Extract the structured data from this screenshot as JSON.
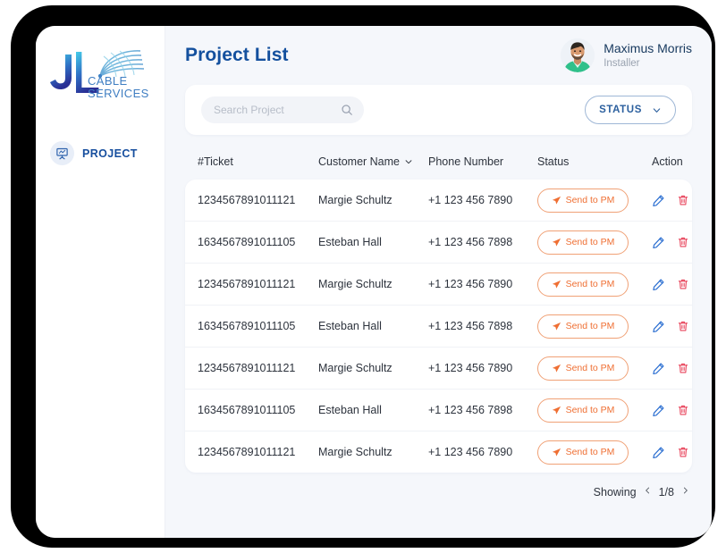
{
  "brand": {
    "initials": "JL",
    "line1": "CABLE",
    "line2": "SERVICES",
    "colors": {
      "gradient_start": "#3fc9e8",
      "gradient_end": "#2b3fa0"
    }
  },
  "sidebar": {
    "items": [
      {
        "label": "PROJECT",
        "icon": "project-board-icon",
        "active": true
      }
    ]
  },
  "header": {
    "title": "Project List",
    "user": {
      "name": "Maximus Morris",
      "role": "Installer",
      "avatar": "user-photo"
    }
  },
  "search": {
    "placeholder": "Search Project",
    "value": "",
    "icon": "search-icon"
  },
  "status_filter": {
    "label": "STATUS",
    "icon": "chevron-down-icon",
    "border_color": "#9fb7d6",
    "text_color": "#2b5f9e"
  },
  "table": {
    "columns": [
      {
        "key": "ticket",
        "label": "#Ticket",
        "sortable": false
      },
      {
        "key": "name",
        "label": "Customer Name",
        "sortable": true,
        "icon": "chevron-down-icon"
      },
      {
        "key": "phone",
        "label": "Phone Number",
        "sortable": false
      },
      {
        "key": "status",
        "label": "Status",
        "sortable": false
      },
      {
        "key": "action",
        "label": "Action",
        "sortable": false
      }
    ],
    "status_action": {
      "label": "Send to PM",
      "icon": "send-plane-icon",
      "color": "#ef6f33",
      "border_color": "#f0a176"
    },
    "row_actions": [
      {
        "name": "edit-icon",
        "color": "#2c6fd1"
      },
      {
        "name": "delete-icon",
        "color": "#e8455c"
      }
    ],
    "rows": [
      {
        "ticket": "1234567891011121",
        "name": "Margie Schultz",
        "phone": "+1 123 456 7890",
        "status": "Send to PM"
      },
      {
        "ticket": "1634567891011105",
        "name": "Esteban Hall",
        "phone": "+1 123 456 7898",
        "status": "Send to PM"
      },
      {
        "ticket": "1234567891011121",
        "name": "Margie Schultz",
        "phone": "+1 123 456 7890",
        "status": "Send to PM"
      },
      {
        "ticket": "1634567891011105",
        "name": "Esteban Hall",
        "phone": "+1 123 456 7898",
        "status": "Send to PM"
      },
      {
        "ticket": "1234567891011121",
        "name": "Margie Schultz",
        "phone": "+1 123 456 7890",
        "status": "Send to PM"
      },
      {
        "ticket": "1634567891011105",
        "name": "Esteban Hall",
        "phone": "+1 123 456 7898",
        "status": "Send to PM"
      },
      {
        "ticket": "1234567891011121",
        "name": "Margie Schultz",
        "phone": "+1 123 456 7890",
        "status": "Send to PM"
      }
    ]
  },
  "pagination": {
    "showing_label": "Showing",
    "prev_icon": "chevron-left-icon",
    "next_icon": "chevron-right-icon",
    "index": "1/8",
    "current_page": 1,
    "total_pages": 8
  }
}
